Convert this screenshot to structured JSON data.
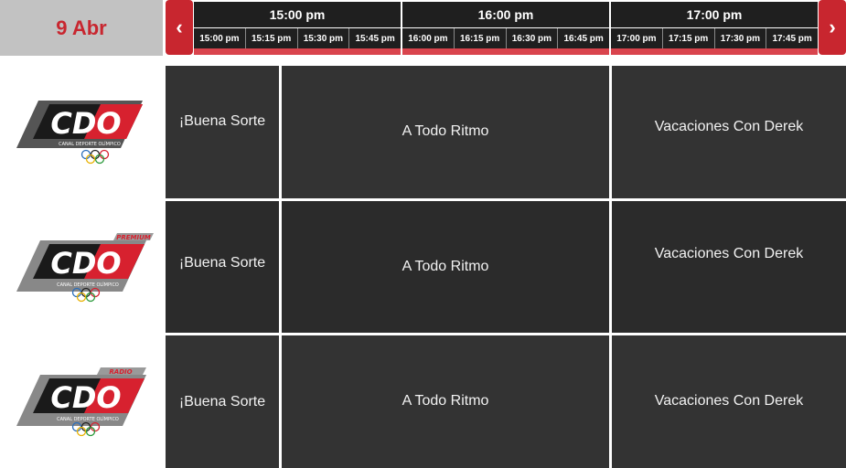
{
  "header": {
    "date": "9 Abr",
    "prev_icon": "chevron-left-icon",
    "next_icon": "chevron-right-icon",
    "hours": [
      "15:00 pm",
      "16:00 pm",
      "17:00 pm"
    ],
    "quarters": [
      [
        "15:00 pm",
        "15:15 pm",
        "15:30 pm",
        "15:45 pm"
      ],
      [
        "16:00 pm",
        "16:15 pm",
        "16:30 pm",
        "16:45 pm"
      ],
      [
        "17:00 pm",
        "17:15 pm",
        "17:30 pm",
        "17:45 pm"
      ]
    ]
  },
  "channels": [
    {
      "logo": {
        "text": "CDO",
        "subtitle": "CANAL DEPORTE OLÍMPICO",
        "tag": ""
      },
      "programs": [
        "¡Buena Sorte",
        "A Todo Ritmo",
        "Vacaciones Con Derek"
      ]
    },
    {
      "logo": {
        "text": "CDO",
        "subtitle": "CANAL DEPORTE OLÍMPICO",
        "tag": "PREMIUM"
      },
      "programs": [
        "¡Buena Sorte",
        "A Todo Ritmo",
        "Vacaciones Con Derek"
      ]
    },
    {
      "logo": {
        "text": "CDO",
        "subtitle": "CANAL DEPORTE OLÍMPICO",
        "tag": "RADIO"
      },
      "programs": [
        "¡Buena Sorte",
        "A Todo Ritmo",
        "Vacaciones Con Derek"
      ]
    }
  ],
  "colors": {
    "accent": "#c8262f",
    "cell_dark": "#333333",
    "header_dark": "#1f1f1f"
  }
}
